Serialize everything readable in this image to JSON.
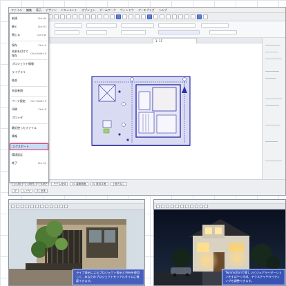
{
  "main_window": {
    "menu": [
      "ファイル",
      "編集",
      "表示",
      "デザイン",
      "ドキュメント",
      "オプション",
      "チームワーク",
      "ウィンドウ",
      "アーキプラグ",
      "ヘルプ"
    ],
    "tab_active": "1. 1F",
    "dropdown": {
      "items": [
        {
          "label": "新規",
          "shortcut": "Ctrl+N"
        },
        {
          "label": "開く",
          "shortcut": "Ctrl+O"
        },
        {
          "label": "閉じる",
          "shortcut": "Ctrl+W"
        },
        {
          "label": "保存",
          "shortcut": "Ctrl+S"
        },
        {
          "label": "名前を付けて保存",
          "shortcut": "Ctrl+Shift+S"
        },
        {
          "label": "プロジェクト情報",
          "shortcut": ""
        },
        {
          "label": "ライブラリ",
          "shortcut": ""
        },
        {
          "label": "結合",
          "shortcut": ""
        },
        {
          "label": "外部参照",
          "shortcut": ""
        },
        {
          "label": "ページ設定",
          "shortcut": "Ctrl+Shift+P"
        },
        {
          "label": "印刷",
          "shortcut": "Ctrl+P"
        },
        {
          "label": "プロッタ",
          "shortcut": ""
        },
        {
          "label": "最近使ったファイル",
          "shortcut": ""
        },
        {
          "label": "情報",
          "shortcut": ""
        },
        {
          "label": "エクスポート",
          "shortcut": ""
        },
        {
          "label": "環境設定",
          "shortcut": ""
        },
        {
          "label": "終了",
          "shortcut": "Ctrl+Q"
        }
      ],
      "highlight_index": 14
    },
    "status_chips_row1": [
      "1:100",
      "100%",
      "0.00°",
      "モデル全体",
      "01 建築図面",
      "01 既存平面",
      "上書きなし"
    ],
    "status_chips_row2": [
      "1F",
      "レイヤ",
      "01 全体"
    ],
    "accent": "#3d5fb3",
    "plan_fill": "#d9dbf3",
    "plan_stroke": "#2f2fa8"
  },
  "bottom_left": {
    "caption": "ライブ表示によるプロジェクト表示と共有を使用して、あなたのプロジェクトをリアルタイムに確認できます。"
  },
  "bottom_right": {
    "caption": "Twinmotionで美しいビジュアライゼーションをすばやく作成、テクスチャやライティングを調整できます。"
  }
}
